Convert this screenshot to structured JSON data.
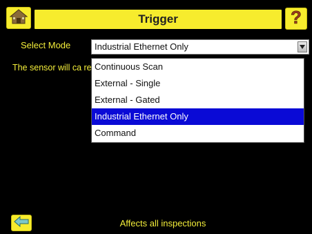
{
  "title": "Trigger",
  "select_mode": {
    "label": "Select Mode",
    "value": "Industrial Ethernet Only"
  },
  "description": "The sensor will ca received through I",
  "dropdown": {
    "options": [
      {
        "label": "Continuous Scan",
        "selected": false
      },
      {
        "label": "External - Single",
        "selected": false
      },
      {
        "label": "External - Gated",
        "selected": false
      },
      {
        "label": "Industrial Ethernet Only",
        "selected": true
      },
      {
        "label": "Command",
        "selected": false
      }
    ]
  },
  "footer": "Affects all inspections",
  "colors": {
    "accent": "#f7ec2d",
    "background": "#000000",
    "selection": "#0a0ad6"
  },
  "icons": {
    "home": "home-icon",
    "help": "question-mark-icon",
    "back": "arrow-left-icon",
    "select_arrow": "chevron-down-icon"
  }
}
